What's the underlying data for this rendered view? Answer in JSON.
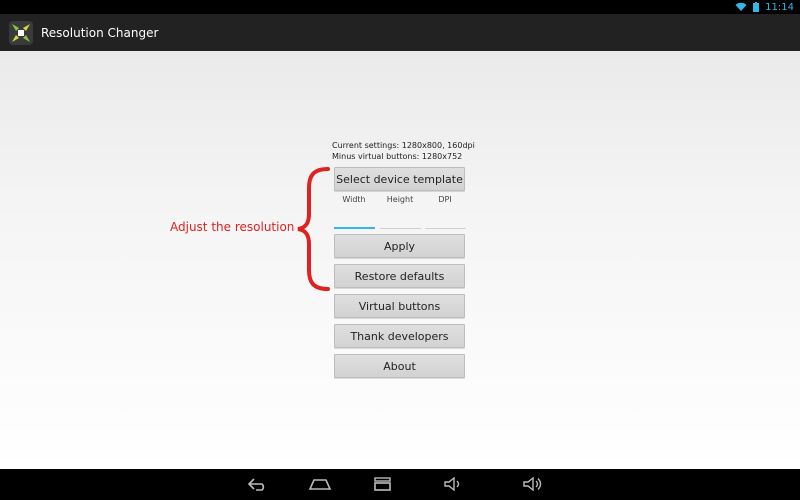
{
  "status_bar": {
    "time": "11:14",
    "icons": [
      "wifi-icon",
      "battery-icon"
    ]
  },
  "action_bar": {
    "title": "Resolution Changer",
    "icon": "app-logo-icon"
  },
  "settings": {
    "current": "Current settings: 1280x800, 160dpi",
    "minus_virtual": "Minus virtual buttons: 1280x752"
  },
  "buttons": {
    "select_template": "Select device template",
    "apply": "Apply",
    "restore": "Restore defaults",
    "virtual": "Virtual buttons",
    "thank": "Thank developers",
    "about": "About"
  },
  "fields": {
    "width_label": "Width",
    "height_label": "Height",
    "dpi_label": "DPI",
    "width_value": "",
    "height_value": "",
    "dpi_value": ""
  },
  "annotation": {
    "text": "Adjust the resolution",
    "color": "#e0221f"
  },
  "nav_bar": {
    "icons": [
      "back-icon",
      "home-icon",
      "recent-apps-icon",
      "volume-down-icon",
      "volume-up-icon"
    ]
  },
  "colors": {
    "accent": "#33b5e5",
    "action_bar": "#222222",
    "annotation": "#e0221f"
  }
}
